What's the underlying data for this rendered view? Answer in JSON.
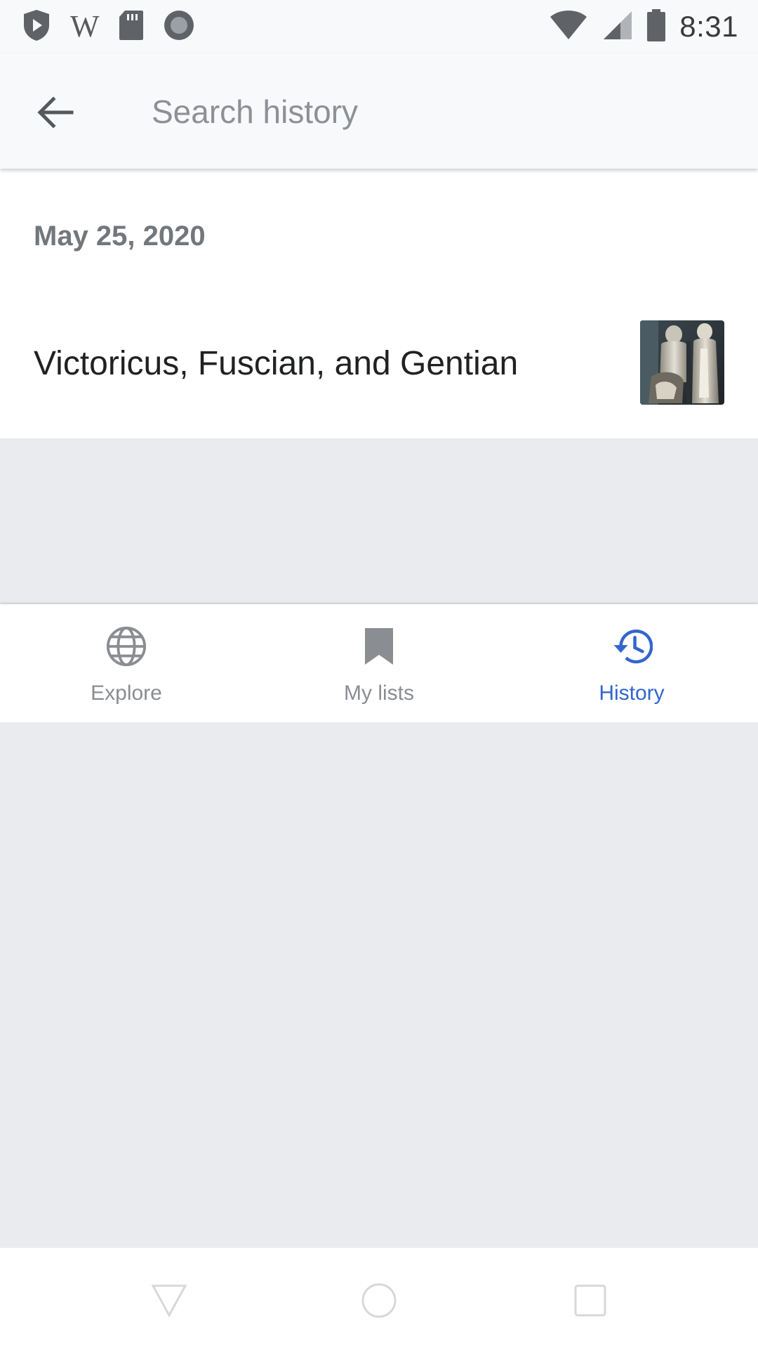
{
  "status_bar": {
    "time": "8:31",
    "left_icons": [
      "shield-play-icon",
      "wikipedia-w-icon",
      "sd-card-icon",
      "record-icon"
    ],
    "wiki_letter": "W",
    "right_icons": [
      "wifi-icon",
      "cell-signal-icon",
      "battery-icon"
    ]
  },
  "toolbar": {
    "back_icon": "arrow-left-icon",
    "search_placeholder": "Search history",
    "search_value": ""
  },
  "history": {
    "date_header": "May 25, 2020",
    "items": [
      {
        "title": "Victoricus, Fuscian, and Gentian",
        "thumbnail": "statue-thumbnail"
      }
    ]
  },
  "bottom_nav": {
    "items": [
      {
        "label": "Explore",
        "icon": "globe-icon",
        "active": false
      },
      {
        "label": "My lists",
        "icon": "bookmark-icon",
        "active": false
      },
      {
        "label": "History",
        "icon": "history-icon",
        "active": true
      }
    ],
    "active_color": "#3366cc",
    "inactive_color": "#8a8d92"
  },
  "system_nav": {
    "buttons": [
      "back-triangle-icon",
      "home-circle-icon",
      "recents-square-icon"
    ]
  }
}
